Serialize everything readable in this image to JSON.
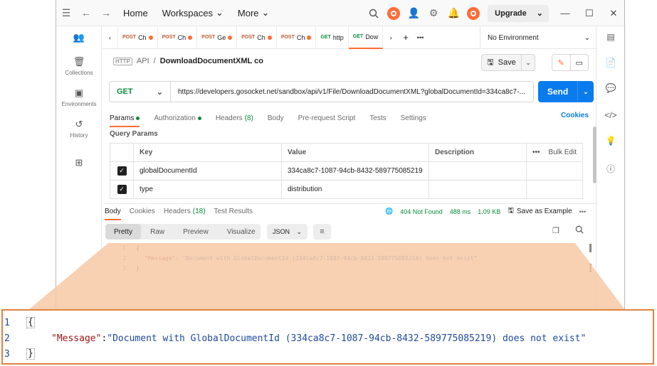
{
  "topbar": {
    "home": "Home",
    "workspaces": "Workspaces",
    "more": "More",
    "upgrade": "Upgrade"
  },
  "sidebar": {
    "items": [
      {
        "label": ""
      },
      {
        "label": "Collections"
      },
      {
        "label": "Environments"
      },
      {
        "label": "History"
      },
      {
        "label": ""
      }
    ]
  },
  "tabs": [
    {
      "method": "POST",
      "name": "Ch"
    },
    {
      "method": "POST",
      "name": "Ch"
    },
    {
      "method": "POST",
      "name": "Ge"
    },
    {
      "method": "POST",
      "name": "Ch"
    },
    {
      "method": "POST",
      "name": "Ch"
    },
    {
      "method": "GET",
      "name": "http"
    },
    {
      "method": "GET",
      "name": "Dow"
    }
  ],
  "environment": "No Environment",
  "breadcrumb": {
    "collection": "API",
    "separator": "/",
    "request": "DownloadDocumentXML co"
  },
  "save_label": "Save",
  "request": {
    "method": "GET",
    "url": "https://developers.gosocket.net/sandbox/api/v1/File/DownloadDocumentXML?globalDocumentId=334ca8c7-...",
    "send_label": "Send"
  },
  "request_tabs": {
    "params": "Params",
    "authorization": "Authorization",
    "headers": "Headers",
    "headers_count": "(8)",
    "body": "Body",
    "prerequest": "Pre-request Script",
    "tests": "Tests",
    "settings": "Settings",
    "cookies": "Cookies"
  },
  "query_params": {
    "title": "Query Params",
    "columns": [
      "Key",
      "Value",
      "Description"
    ],
    "bulk_edit": "Bulk Edit",
    "rows": [
      {
        "key": "globalDocumentId",
        "value": "334ca8c7-1087-94cb-8432-589775085219",
        "description": ""
      },
      {
        "key": "type",
        "value": "distribution",
        "description": ""
      }
    ]
  },
  "response_tabs": {
    "body": "Body",
    "cookies": "Cookies",
    "headers": "Headers",
    "headers_count": "(18)",
    "test_results": "Test Results"
  },
  "response_status": {
    "status": "404 Not Found",
    "time": "488 ms",
    "size": "1.09 KB",
    "save_example": "Save as Example"
  },
  "view_modes": [
    "Pretty",
    "Raw",
    "Preview",
    "Visualize"
  ],
  "format": "JSON",
  "response_body": {
    "line_numbers": [
      "1",
      "2",
      "3"
    ],
    "open_brace": "{",
    "key": "\"Message\"",
    "colon": ": ",
    "value": "\"Document with GlobalDocumentId (334ca8c7-1087-94cb-8432-589775085219) does not exist\"",
    "close_brace": "}"
  },
  "colors": {
    "accent": "#ff6c37",
    "send": "#097bed",
    "get_method": "#0b8a3c",
    "zoom_border": "#e0823e",
    "zoom_fill": "#f7c9a6"
  }
}
